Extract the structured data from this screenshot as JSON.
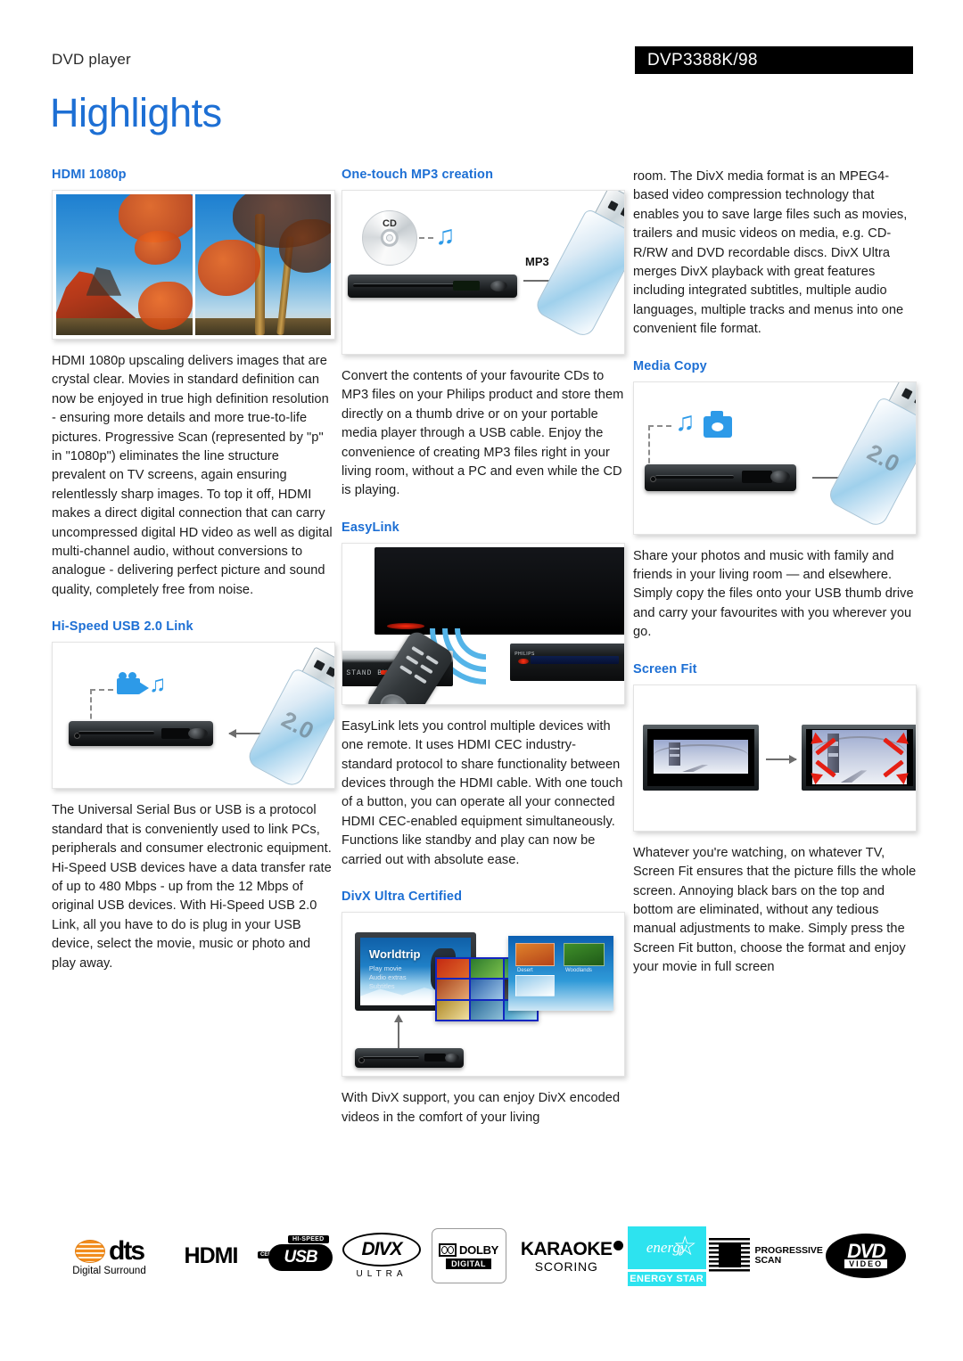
{
  "header": {
    "category": "DVD player",
    "model": "DVP3388K/98",
    "page_title": "Highlights",
    "accent_color": "#1d6fd4"
  },
  "columns": {
    "left": [
      {
        "heading": "HDMI 1080p",
        "figure": "hdmi-landscape-photo",
        "body": "HDMI 1080p upscaling delivers images that are crystal clear. Movies in standard definition can now be enjoyed in true high definition resolution - ensuring more details and more true-to-life pictures. Progressive Scan (represented by \"p\" in \"1080p\") eliminates the line structure prevalent on TV screens, again ensuring relentlessly sharp images. To top it off, HDMI makes a direct digital connection that can carry uncompressed digital HD video as well as digital multi-channel audio, without conversions to analogue - delivering perfect picture and sound quality, completely free from noise."
      },
      {
        "heading": "Hi-Speed USB 2.0 Link",
        "figure": "usb-link-diagram",
        "body": "The Universal Serial Bus or USB is a protocol standard that is conveniently used to link PCs, peripherals and consumer electronic equipment. Hi-Speed USB devices have a data transfer rate of up to 480 Mbps - up from the 12 Mbps of original USB devices. With Hi-Speed USB 2.0 Link, all you have to do is plug in your USB device, select the movie, music or photo and play away."
      }
    ],
    "middle": [
      {
        "heading": "One-touch MP3 creation",
        "figure": "mp3-creation-diagram",
        "body": "Convert the contents of your favourite CDs to MP3 files on your Philips product and store them directly on a thumb drive or on your portable media player through a USB cable. Enjoy the convenience of creating MP3 files right in your living room, without a PC and even while the CD is playing."
      },
      {
        "heading": "EasyLink",
        "figure": "easylink-diagram",
        "body": "EasyLink lets you control multiple devices with one remote. It uses HDMI CEC industry-standard protocol to share functionality between devices through the HDMI cable. With one touch of a button, you can operate all your connected HDMI CEC-enabled equipment simultaneously. Functions like standby and play can now be carried out with absolute ease."
      },
      {
        "heading": "DivX Ultra Certified",
        "figure": "divx-diagram",
        "body": "With DivX support, you can enjoy DivX encoded videos in the comfort of your living"
      }
    ],
    "right": [
      {
        "heading": "",
        "figure": "",
        "body": "room. The DivX media format is an MPEG4-based video compression technology that enables you to save large files such as movies, trailers and music videos on media, e.g. CD-R/RW and DVD recordable discs. DivX Ultra merges DivX playback with great features including integrated subtitles, multiple audio languages, multiple tracks and menus into one convenient file format."
      },
      {
        "heading": "Media Copy",
        "figure": "media-copy-diagram",
        "body": "Share your photos and music with family and friends in your living room — and elsewhere. Simply copy the files onto your USB thumb drive and carry your favourites with you wherever you go."
      },
      {
        "heading": "Screen Fit",
        "figure": "screen-fit-diagram",
        "body": "Whatever you're watching, on whatever TV, Screen Fit ensures that the picture fills the whole screen. Annoying black bars on the top and bottom are eliminated, without any tedious manual adjustments to make. Simply press the Screen Fit button, choose the format and enjoy your movie in full screen"
      }
    ]
  },
  "figure_labels": {
    "cd_disc": "CD",
    "mp3_arrow": "MP3",
    "usb_version": "2.0",
    "standby": "STAND BY",
    "philips_brand": "PHILIPS",
    "divx_menu_title": "Worldtrip",
    "divx_menu_items": [
      "Play movie",
      "Audio extras",
      "Subtitles"
    ],
    "divx_panel_captions": [
      "Desert",
      "Woodlands"
    ]
  },
  "logos": [
    {
      "name": "dts-logo",
      "word": "dts",
      "sub": "Digital Surround"
    },
    {
      "name": "hdmi-logo",
      "word": "HDMI"
    },
    {
      "name": "hi-speed-usb-logo",
      "word": "USB",
      "top": "HI-SPEED",
      "left": "CERTIFIED"
    },
    {
      "name": "divx-ultra-logo",
      "word": "DIVX",
      "sub": "ULTRA"
    },
    {
      "name": "dolby-digital-logo",
      "word": "DOLBY",
      "sub": "DIGITAL"
    },
    {
      "name": "karaoke-scoring-logo",
      "word": "KARAOKE",
      "sub": "SCORING"
    },
    {
      "name": "energy-star-logo",
      "word": "energy",
      "sub": "ENERGY STAR"
    },
    {
      "name": "progressive-scan-logo",
      "word": "PROGRESSIVE",
      "sub": "SCAN"
    },
    {
      "name": "dvd-video-logo",
      "word": "DVD",
      "sub": "VIDEO"
    }
  ]
}
